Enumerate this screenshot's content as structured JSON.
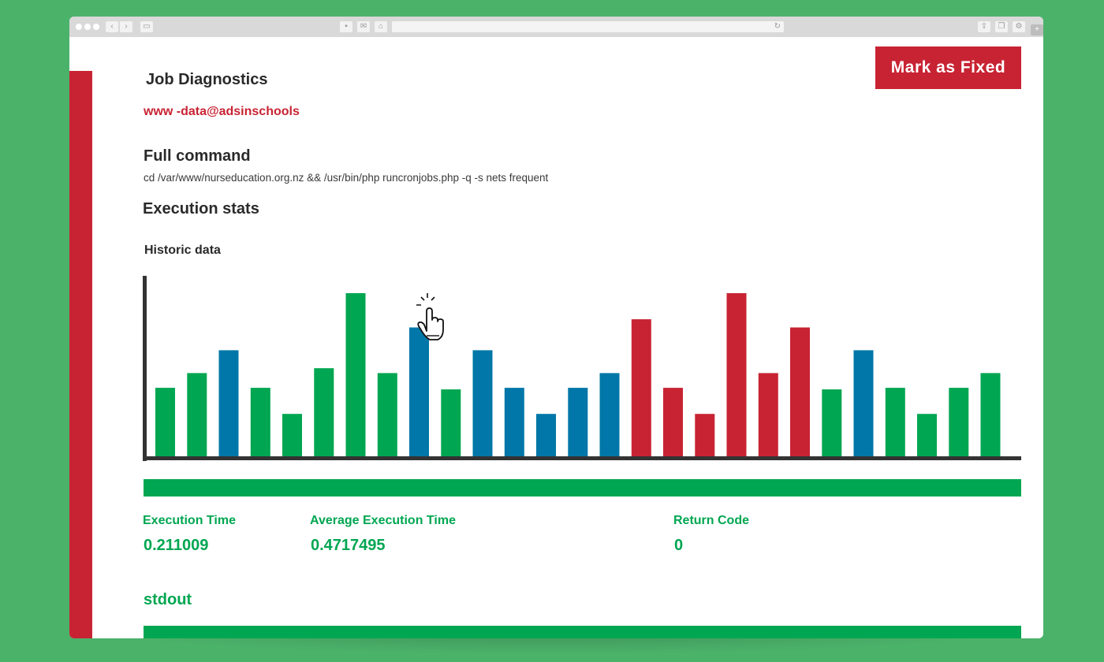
{
  "browser": {
    "toolbar_icons": [
      "window-controls",
      "back-icon",
      "forward-icon",
      "sidebar-icon",
      "print-icon",
      "mail-icon",
      "home-icon",
      "reload-icon",
      "share-icon",
      "tabs-icon",
      "settings-icon"
    ]
  },
  "header": {
    "title": "Job Diagnostics",
    "user": "www -data@adsinschools",
    "mark_fixed_label": "Mark as Fixed"
  },
  "command": {
    "heading": "Full command",
    "text": "cd /var/www/nurseducation.org.nz && /usr/bin/php runcronjobs.php -q -s nets frequent"
  },
  "execution": {
    "heading": "Execution stats",
    "historic_heading": "Historic data"
  },
  "colors": {
    "green": "#00a651",
    "blue": "#0077a8",
    "red": "#c82333",
    "background": "#4bb26a"
  },
  "chart_data": {
    "type": "bar",
    "title": "",
    "xlabel": "",
    "ylabel": "",
    "ylim": [
      0,
      1
    ],
    "values": [
      0.42,
      0.51,
      0.65,
      0.42,
      0.26,
      0.54,
      1.0,
      0.51,
      0.79,
      0.41,
      0.65,
      0.42,
      0.26,
      0.42,
      0.51,
      0.84,
      0.42,
      0.26,
      1.0,
      0.51,
      0.79,
      0.41,
      0.65,
      0.42,
      0.26,
      0.42,
      0.51
    ],
    "colors": [
      "green",
      "green",
      "blue",
      "green",
      "green",
      "green",
      "green",
      "green",
      "blue",
      "green",
      "blue",
      "blue",
      "blue",
      "blue",
      "blue",
      "red",
      "red",
      "red",
      "red",
      "red",
      "red",
      "green",
      "blue",
      "green",
      "green",
      "green",
      "green"
    ],
    "highlighted_index": 6,
    "grid": false,
    "legend": "none"
  },
  "stats": {
    "execution_time_label": "Execution Time",
    "execution_time_value": "0.211009",
    "average_label": "Average Execution Time",
    "average_value": "0.4717495",
    "return_code_label": "Return Code",
    "return_code_value": "0"
  },
  "stdout": {
    "heading": "stdout"
  }
}
